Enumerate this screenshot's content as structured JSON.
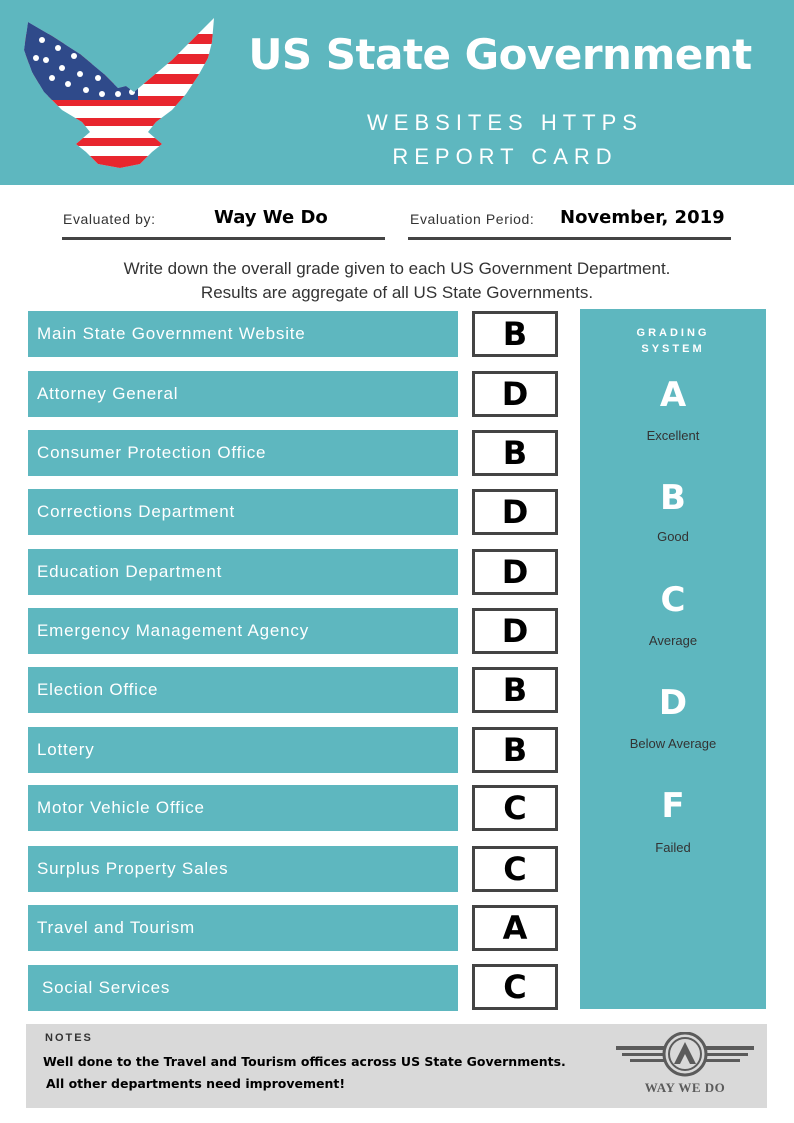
{
  "header": {
    "title": "US State Government",
    "subtitle_line1": "WEBSITES HTTPS",
    "subtitle_line2": "REPORT CARD",
    "logo_icon": "eagle-flag-icon"
  },
  "evaluation": {
    "evaluated_by_label": "Evaluated by:",
    "evaluated_by_value": "Way We Do",
    "period_label": "Evaluation Period:",
    "period_value": "November, 2019"
  },
  "instructions": {
    "line1": "Write down the overall grade given to each US Government Department.",
    "line2": "Results are aggregate of all US State Governments."
  },
  "departments": [
    {
      "name": "Main State Government Website",
      "grade": "B"
    },
    {
      "name": "Attorney General",
      "grade": "D"
    },
    {
      "name": "Consumer Protection Office",
      "grade": "B"
    },
    {
      "name": "Corrections Department",
      "grade": "D"
    },
    {
      "name": "Education Department",
      "grade": "D"
    },
    {
      "name": "Emergency Management Agency",
      "grade": "D"
    },
    {
      "name": "Election Office",
      "grade": "B"
    },
    {
      "name": "Lottery",
      "grade": "B"
    },
    {
      "name": "Motor Vehicle Office",
      "grade": "C"
    },
    {
      "name": "Surplus Property Sales",
      "grade": "C"
    },
    {
      "name": "Travel and Tourism",
      "grade": "A"
    },
    {
      "name": "Social Services",
      "grade": "C"
    }
  ],
  "grading_system": {
    "title_line1": "GRADING",
    "title_line2": "SYSTEM",
    "grades": [
      {
        "letter": "A",
        "description": "Excellent"
      },
      {
        "letter": "B",
        "description": "Good"
      },
      {
        "letter": "C",
        "description": "Average"
      },
      {
        "letter": "D",
        "description": "Below Average"
      },
      {
        "letter": "F",
        "description": "Failed"
      }
    ]
  },
  "notes": {
    "title": "NOTES",
    "line1": "Well done to the Travel and Tourism offices across US State Governments.",
    "line2": "All other departments need improvement!",
    "brand_logo_text": "WAY WE DO",
    "brand_logo_icon": "winged-w-logo-icon"
  },
  "colors": {
    "teal": "#5eb7bf",
    "notes_bg": "#d9d9d9",
    "dark_text": "#333333",
    "flag_blue": "#2f4a8a",
    "flag_red": "#e8262e"
  }
}
